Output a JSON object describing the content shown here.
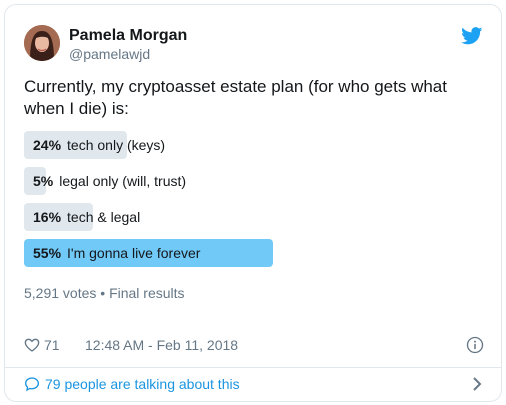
{
  "author": {
    "name": "Pamela Morgan",
    "handle": "@pamelawjd"
  },
  "tweet": {
    "text": "Currently, my cryptoasset estate plan (for who gets what when I die) is:"
  },
  "poll": {
    "options": [
      {
        "percent": "24%",
        "label": "tech only (keys)",
        "value": 24
      },
      {
        "percent": "5%",
        "label": "legal only (will, trust)",
        "value": 5
      },
      {
        "percent": "16%",
        "label": "tech & legal",
        "value": 16
      },
      {
        "percent": "55%",
        "label": "I'm gonna live forever",
        "value": 55
      }
    ],
    "meta": "5,291 votes • Final results"
  },
  "footer": {
    "likes": "71",
    "timestamp": "12:48 AM - Feb 11, 2018",
    "talking": "79 people are talking about this"
  },
  "icons": [
    "heart-icon",
    "info-icon",
    "speech-bubble-icon",
    "chevron-right-icon",
    "twitter-bird-icon"
  ],
  "colors": {
    "accent": "#1b95e0",
    "winning_bar": "#71c9f8",
    "bar": "#e1e8ed",
    "muted": "#657786"
  }
}
